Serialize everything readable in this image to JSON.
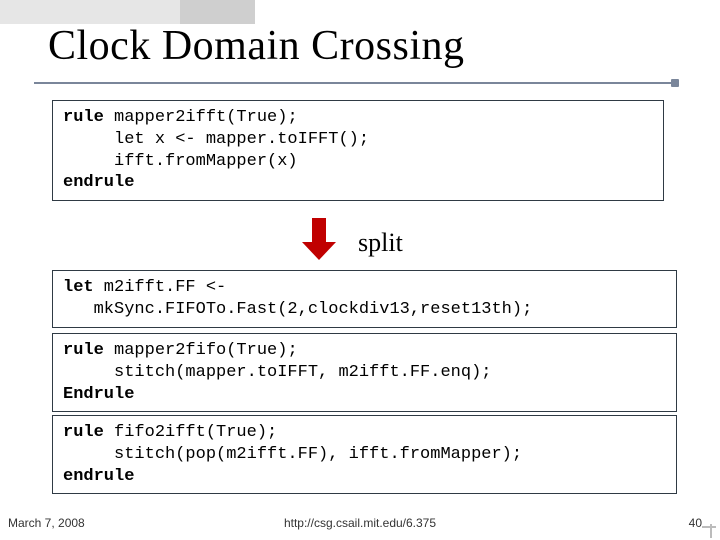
{
  "title": "Clock Domain Crossing",
  "split_label": "split",
  "code": {
    "box1": {
      "l1a": "rule",
      "l1b": " mapper2ifft(True);",
      "l2": "     let x <- mapper.toIFFT();",
      "l3": "     ifft.fromMapper(x)",
      "l4": "endrule"
    },
    "box2": {
      "l1a": "let",
      "l1b": " m2ifft.FF <-",
      "l2": "   mkSync.FIFOTo.Fast(2,clockdiv13,reset13th);"
    },
    "box3": {
      "l1a": "rule",
      "l1b": " mapper2fifo(True);",
      "l2": "     stitch(mapper.toIFFT, m2ifft.FF.enq);",
      "l3": "Endrule"
    },
    "box4": {
      "l1a": "rule",
      "l1b": " fifo2ifft(True);",
      "l2": "     stitch(pop(m2ifft.FF), ifft.fromMapper);",
      "l3": "endrule"
    }
  },
  "footer": {
    "left": "March 7, 2008",
    "center": "http://csg.csail.mit.edu/6.375",
    "right": "40"
  }
}
